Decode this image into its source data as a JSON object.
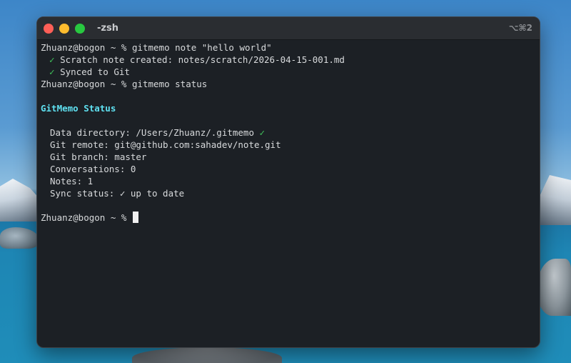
{
  "window": {
    "title": "-zsh",
    "shortcut": "⌥⌘2"
  },
  "terminal": {
    "prompt": "Zhuanz@bogon ~ %",
    "cmd1": "gitmemo note \"hello world\"",
    "check": "✓",
    "out1": "Scratch note created: notes/scratch/2026-04-15-001.md",
    "out2": "Synced to Git",
    "cmd2": "gitmemo status",
    "status_heading": "GitMemo Status",
    "data_dir": "Data directory: /Users/Zhuanz/.gitmemo",
    "git_remote": "Git remote: git@github.com:sahadev/note.git",
    "git_branch": "Git branch: master",
    "conversations": "Conversations: 0",
    "notes": "Notes: 1",
    "sync_status": "Sync status: ✓ up to date"
  }
}
